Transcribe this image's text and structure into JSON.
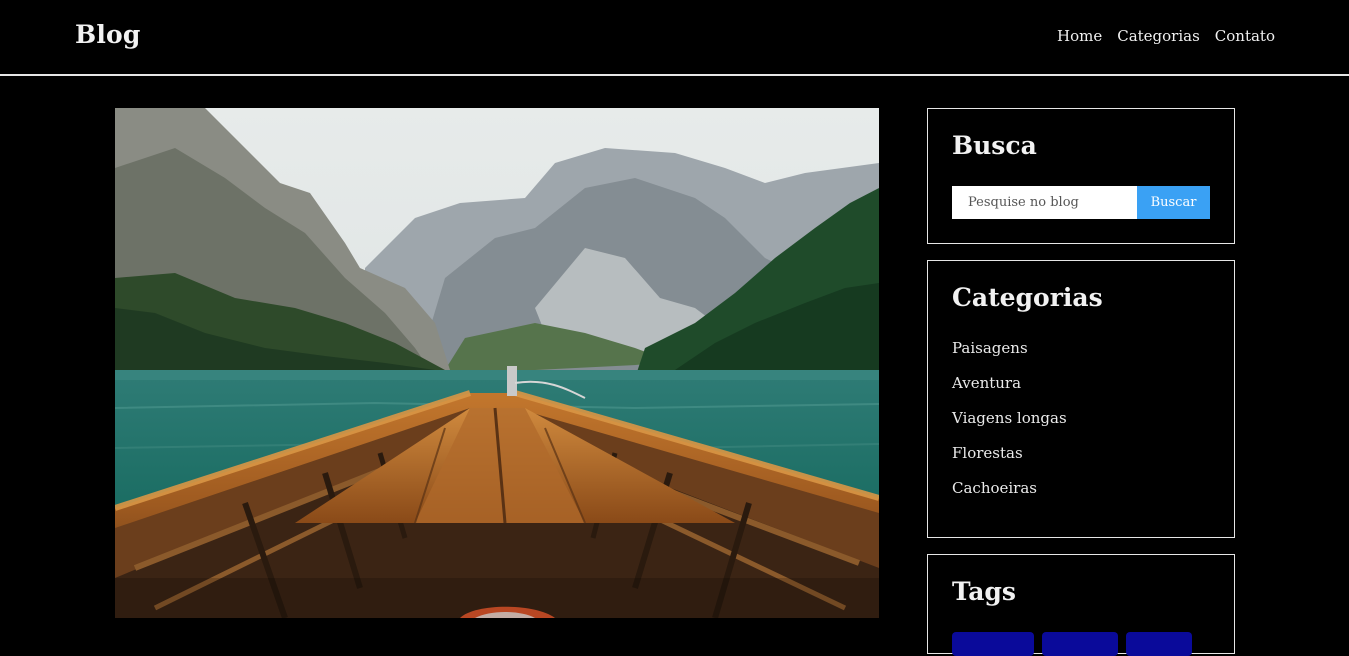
{
  "header": {
    "brand": "Blog",
    "nav": [
      "Home",
      "Categorias",
      "Contato"
    ]
  },
  "sidebar": {
    "search": {
      "title": "Busca",
      "placeholder": "Pesquise no blog",
      "button": "Buscar"
    },
    "categories": {
      "title": "Categorias",
      "items": [
        "Paisagens",
        "Aventura",
        "Viagens longas",
        "Florestas",
        "Cachoeiras"
      ]
    },
    "tags": {
      "title": "Tags"
    }
  },
  "colors": {
    "background": "#000000",
    "button": "#3aa1f4",
    "tag": "#0a0a9a"
  }
}
